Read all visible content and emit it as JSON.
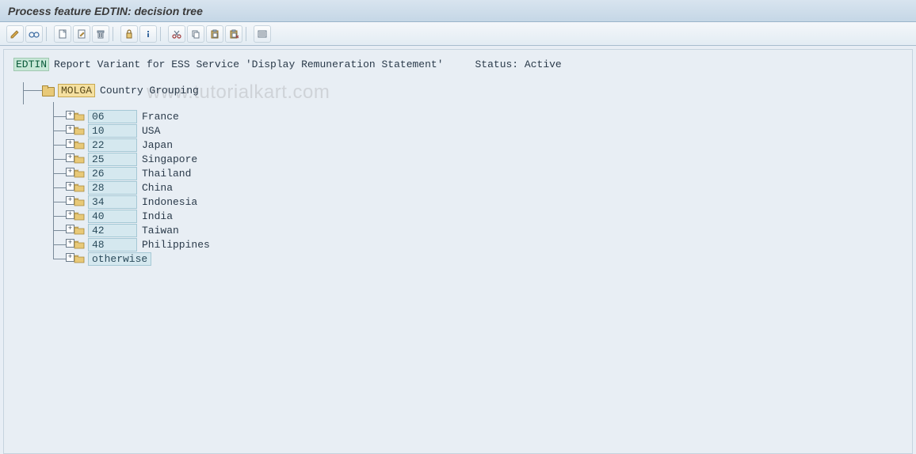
{
  "header": {
    "title": "Process feature EDTIN: decision tree"
  },
  "watermark": "www.tutorialkart.com",
  "toolbar": {
    "icons": [
      "pencil",
      "glasses",
      "new-page",
      "edit-page",
      "trash",
      "lock",
      "info",
      "cut",
      "copy",
      "paste",
      "paste-special",
      "list"
    ]
  },
  "root": {
    "feature": "EDTIN",
    "description": "Report Variant for ESS Service 'Display Remuneration Statement'",
    "status_label": "Status:",
    "status_value": "Active"
  },
  "node": {
    "key": "MOLGA",
    "label": "Country Grouping"
  },
  "children": [
    {
      "code": "06",
      "label": "France"
    },
    {
      "code": "10",
      "label": "USA"
    },
    {
      "code": "22",
      "label": "Japan"
    },
    {
      "code": "25",
      "label": "Singapore"
    },
    {
      "code": "26",
      "label": "Thailand"
    },
    {
      "code": "28",
      "label": "China"
    },
    {
      "code": "34",
      "label": "Indonesia"
    },
    {
      "code": "40",
      "label": "India"
    },
    {
      "code": "42",
      "label": "Taiwan"
    },
    {
      "code": "48",
      "label": "Philippines"
    },
    {
      "code": "otherwise",
      "label": ""
    }
  ]
}
